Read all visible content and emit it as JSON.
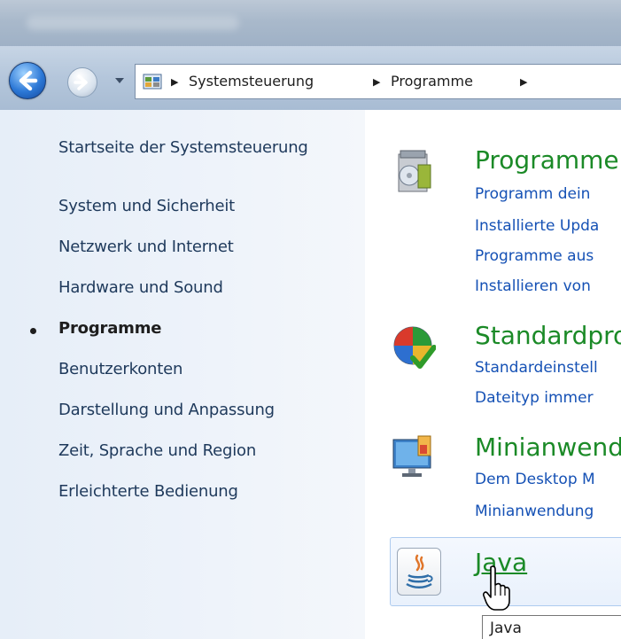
{
  "navigation": {
    "breadcrumbs": [
      "Systemsteuerung",
      "Programme"
    ]
  },
  "sidebar": {
    "items": [
      {
        "label": "Startseite der Systemsteuerung",
        "active": false
      },
      {
        "label": "System und Sicherheit",
        "active": false
      },
      {
        "label": "Netzwerk und Internet",
        "active": false
      },
      {
        "label": "Hardware und Sound",
        "active": false
      },
      {
        "label": "Programme",
        "active": true
      },
      {
        "label": "Benutzerkonten",
        "active": false
      },
      {
        "label": "Darstellung und Anpassung",
        "active": false
      },
      {
        "label": "Zeit, Sprache und Region",
        "active": false
      },
      {
        "label": "Erleichterte Bedienung",
        "active": false
      }
    ]
  },
  "categories": [
    {
      "title": "Programme",
      "icon": "programs-and-features-icon",
      "links": [
        "Programm dein",
        "Installierte Upda",
        "Programme aus",
        "Installieren von"
      ]
    },
    {
      "title": "Standardpro",
      "icon": "default-programs-icon",
      "links": [
        "Standardeinstell",
        "Dateityp immer"
      ]
    },
    {
      "title": "Minianwend",
      "icon": "desktop-gadgets-icon",
      "links": [
        "Dem Desktop M",
        "Minianwendung"
      ]
    },
    {
      "title": "Java",
      "icon": "java-icon",
      "links": []
    }
  ],
  "tooltip": {
    "text": "Java"
  },
  "colors": {
    "category_title": "#1b8a27",
    "link": "#1551b5",
    "sidebar_text": "#1e395b",
    "sidebar_bg": "#e6eef8"
  }
}
